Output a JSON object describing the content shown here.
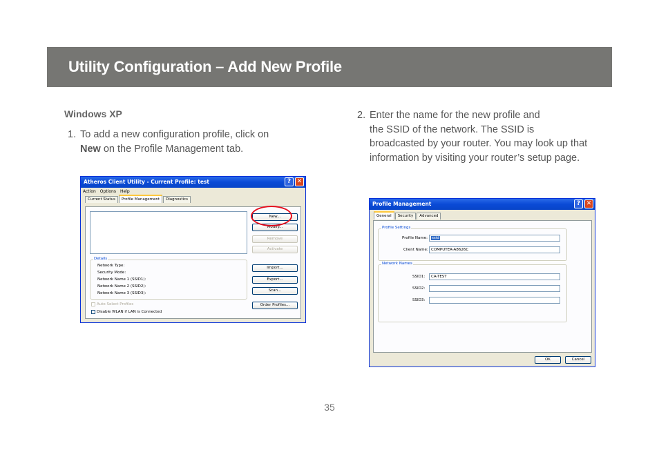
{
  "header": {
    "title": "Utility Configuration – Add New Profile"
  },
  "section": {
    "title": "Windows XP"
  },
  "step1": {
    "number": "1.",
    "text_before": "To add a new configuration profile, click on",
    "bold": "New",
    "text_after": " on the Profile Management tab."
  },
  "step2": {
    "number": "2.",
    "line1": "Enter the name for the new profile and",
    "rest": "the SSID of the network.  The SSID is broadcasted by your router.  You may look up that information by visiting your router’s setup page."
  },
  "window1": {
    "title": "Atheros Client Utility - Current Profile: test",
    "menu": [
      "Action",
      "Options",
      "Help"
    ],
    "tabs": [
      "Current Status",
      "Profile Management",
      "Diagnostics"
    ],
    "buttons": {
      "new": "New...",
      "modify": "Modify...",
      "remove": "Remove",
      "activate": "Activate",
      "import": "Import...",
      "export": "Export...",
      "scan": "Scan...",
      "order": "Order Profiles..."
    },
    "details_label": "Details",
    "details": [
      "Network Type:",
      "Security Mode:",
      "Network Name 1 (SSID1):",
      "Network Name 2 (SSID2):",
      "Network Name 3 (SSID3):"
    ],
    "auto_select": "Auto Select Profiles",
    "disable_wlan": "Disable WLAN if LAN is Connected"
  },
  "window2": {
    "title": "Profile Management",
    "tabs": [
      "General",
      "Security",
      "Advanced"
    ],
    "profile_settings_label": "Profile Settings",
    "profile_name_label": "Profile Name:",
    "profile_name_value": "ssid",
    "client_name_label": "Client Name:",
    "client_name_value": "COMPUTER-A8626C",
    "network_names_label": "Network Names",
    "ssid1_label": "SSID1:",
    "ssid1_value": "CA-TEST",
    "ssid2_label": "SSID2:",
    "ssid2_value": "",
    "ssid3_label": "SSID3:",
    "ssid3_value": "",
    "ok": "OK",
    "cancel": "Cancel"
  },
  "page_number": "35",
  "colors": {
    "banner": "#767673",
    "highlight": "#e3101f",
    "xp_title": "#0a4ad6"
  }
}
